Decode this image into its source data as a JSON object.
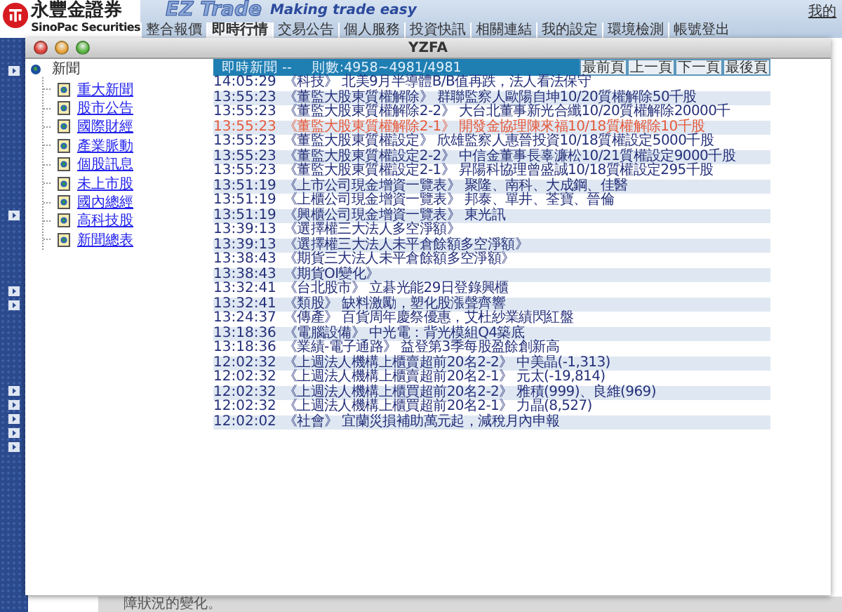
{
  "header": {
    "brand_cn": "永豐金證券",
    "brand_en": "SinoPac Securities",
    "product": "EZ Trade",
    "slogan": "Making trade easy",
    "favorites_link": "我的"
  },
  "nav": [
    {
      "label": "整合報價",
      "selected": false
    },
    {
      "label": "即時行情",
      "selected": true
    },
    {
      "label": "交易公告",
      "selected": false
    },
    {
      "label": "個人服務",
      "selected": false
    },
    {
      "label": "投資快訊",
      "selected": false
    },
    {
      "label": "相關連結",
      "selected": false
    },
    {
      "label": "我的設定",
      "selected": false
    },
    {
      "label": "環境檢測",
      "selected": false
    },
    {
      "label": "帳號登出",
      "selected": false
    }
  ],
  "window": {
    "title": "YZFA"
  },
  "tree": {
    "label": "新聞",
    "children": [
      {
        "label": "重大新聞"
      },
      {
        "label": "股市公告"
      },
      {
        "label": "國際財經"
      },
      {
        "label": "產業脈動"
      },
      {
        "label": "個股訊息"
      },
      {
        "label": "未上市股"
      },
      {
        "label": "國內總經"
      },
      {
        "label": "高科技股"
      },
      {
        "label": "新聞總表"
      }
    ]
  },
  "news": {
    "title": "即時新聞 --",
    "count": "則數:4958~4981/4981",
    "buttons": [
      "最前頁",
      "上一頁",
      "下一頁",
      "最後頁"
    ],
    "rows": [
      {
        "time": "14:05:29",
        "text": "《科技》 北美9月半導體B/B值再跌，法人看法保守",
        "highlighted": false
      },
      {
        "time": "13:55:23",
        "text": "《董監大股東質權解除》 群聯監察人歐陽自坤10/20質權解除50千股",
        "highlighted": false
      },
      {
        "time": "13:55:23",
        "text": "《董監大股東質權解除2-2》 大台北董事新光合纖10/20質權解除20000千",
        "highlighted": false
      },
      {
        "time": "13:55:23",
        "text": "《董監大股東質權解除2-1》 開發金協理陳來福10/18質權解除10千股",
        "highlighted": true
      },
      {
        "time": "13:55:23",
        "text": "《董監大股東質權設定》 欣雄監察人惠晉投資10/18質權設定5000千股",
        "highlighted": false
      },
      {
        "time": "13:55:23",
        "text": "《董監大股東質權設定2-2》 中信金董事長辜濂松10/21質權設定9000千股",
        "highlighted": false
      },
      {
        "time": "13:55:23",
        "text": "《董監大股東質權設定2-1》 昇陽科協理曾盛誠10/18質權設定295千股",
        "highlighted": false
      },
      {
        "time": "13:51:19",
        "text": "《上市公司現金增資一覽表》 聚隆、南科、大成鋼、佳醫",
        "highlighted": false
      },
      {
        "time": "13:51:19",
        "text": "《上櫃公司現金增資一覽表》 邦泰、單井、荃寶、晉倫",
        "highlighted": false
      },
      {
        "time": "13:51:19",
        "text": "《興櫃公司現金增資一覽表》 東光訊",
        "highlighted": false
      },
      {
        "time": "13:39:13",
        "text": "《選擇權三大法人多空淨額》",
        "highlighted": false
      },
      {
        "time": "13:39:13",
        "text": "《選擇權三大法人未平倉餘額多空淨額》",
        "highlighted": false
      },
      {
        "time": "13:38:43",
        "text": "《期貨三大法人未平倉餘額多空淨額》",
        "highlighted": false
      },
      {
        "time": "13:38:43",
        "text": "《期貨OI變化》",
        "highlighted": false
      },
      {
        "time": "13:32:41",
        "text": "《台北股市》 立碁光能29日登錄興櫃",
        "highlighted": false
      },
      {
        "time": "13:32:41",
        "text": "《類股》 缺料激勵，塑化股漲聲齊響",
        "highlighted": false
      },
      {
        "time": "13:24:37",
        "text": "《傳產》 百貨周年慶祭優惠，艾杜紗業績閃紅盤",
        "highlighted": false
      },
      {
        "time": "13:18:36",
        "text": "《電腦設備》 中光電：背光模組Q4築底",
        "highlighted": false
      },
      {
        "time": "13:18:36",
        "text": "《業績-電子通路》 益登第3季每股盈餘創新高",
        "highlighted": false
      },
      {
        "time": "12:02:32",
        "text": "《上週法人機構上櫃賣超前20名2-2》 中美晶(-1,313)",
        "highlighted": false
      },
      {
        "time": "12:02:32",
        "text": "《上週法人機構上櫃賣超前20名2-1》 元太(-19,814)",
        "highlighted": false
      },
      {
        "time": "12:02:32",
        "text": "《上週法人機構上櫃買超前20名2-2》 雅積(999)、良維(969)",
        "highlighted": false
      },
      {
        "time": "12:02:32",
        "text": "《上週法人機構上櫃買超前20名2-1》 力晶(8,527)",
        "highlighted": false
      },
      {
        "time": "12:02:02",
        "text": "《社會》 宜蘭災損補助萬元起，減稅月內申報",
        "highlighted": false
      }
    ]
  },
  "background": {
    "footer_text": "障狀況的變化。"
  }
}
